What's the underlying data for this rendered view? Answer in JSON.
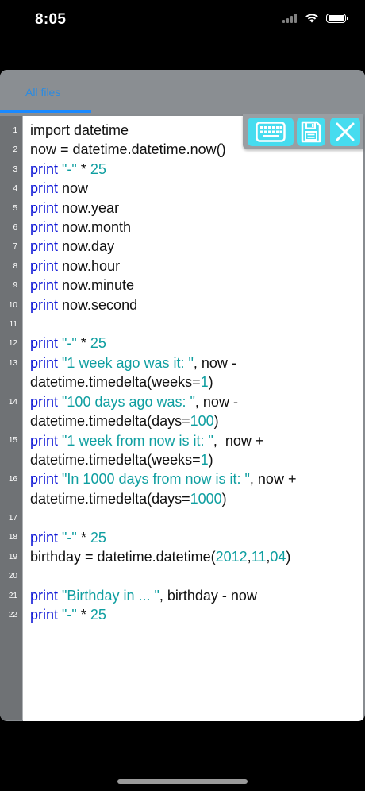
{
  "status_bar": {
    "time": "8:05"
  },
  "tabs": [
    {
      "label": "All files",
      "selected": true
    }
  ],
  "toolbar": {
    "keyboard_icon": "keyboard-icon",
    "save_icon": "floppy-disk-icon",
    "close_icon": "close-x-icon",
    "accent_color": "#46dcef"
  },
  "editor": {
    "line_numbers": [
      "1",
      "2",
      "3",
      "4",
      "5",
      "6",
      "7",
      "8",
      "9",
      "10",
      "11",
      "12",
      "13",
      "14",
      "15",
      "16",
      "17",
      "18",
      "19",
      "20",
      "21",
      "22"
    ],
    "lines": [
      [
        {
          "t": "import datetime",
          "c": ""
        }
      ],
      [
        {
          "t": "now = datetime.datetime.now()",
          "c": ""
        }
      ],
      [
        {
          "t": "print",
          "c": "kw"
        },
        {
          "t": " ",
          "c": ""
        },
        {
          "t": "\"-\"",
          "c": "str"
        },
        {
          "t": " * ",
          "c": ""
        },
        {
          "t": "25",
          "c": "num"
        }
      ],
      [
        {
          "t": "print",
          "c": "kw"
        },
        {
          "t": " now",
          "c": ""
        }
      ],
      [
        {
          "t": "print",
          "c": "kw"
        },
        {
          "t": " now.year",
          "c": ""
        }
      ],
      [
        {
          "t": "print",
          "c": "kw"
        },
        {
          "t": " now.month",
          "c": ""
        }
      ],
      [
        {
          "t": "print",
          "c": "kw"
        },
        {
          "t": " now.day",
          "c": ""
        }
      ],
      [
        {
          "t": "print",
          "c": "kw"
        },
        {
          "t": " now.hour",
          "c": ""
        }
      ],
      [
        {
          "t": "print",
          "c": "kw"
        },
        {
          "t": " now.minute",
          "c": ""
        }
      ],
      [
        {
          "t": "print",
          "c": "kw"
        },
        {
          "t": " now.second",
          "c": ""
        }
      ],
      [
        {
          "t": "",
          "c": ""
        }
      ],
      [
        {
          "t": "print",
          "c": "kw"
        },
        {
          "t": " ",
          "c": ""
        },
        {
          "t": "\"-\"",
          "c": "str"
        },
        {
          "t": " * ",
          "c": ""
        },
        {
          "t": "25",
          "c": "num"
        }
      ],
      [
        {
          "t": "print",
          "c": "kw"
        },
        {
          "t": " ",
          "c": ""
        },
        {
          "t": "\"1 week ago was it: \"",
          "c": "str"
        },
        {
          "t": ", now -",
          "c": ""
        }
      ],
      [
        {
          "t": "datetime.timedelta(weeks=",
          "c": ""
        },
        {
          "t": "1",
          "c": "num"
        },
        {
          "t": ")",
          "c": ""
        }
      ],
      [
        {
          "t": "print",
          "c": "kw"
        },
        {
          "t": " ",
          "c": ""
        },
        {
          "t": "\"100 days ago was: \"",
          "c": "str"
        },
        {
          "t": ", now -",
          "c": ""
        }
      ],
      [
        {
          "t": "datetime.timedelta(days=",
          "c": ""
        },
        {
          "t": "100",
          "c": "num"
        },
        {
          "t": ")",
          "c": ""
        }
      ],
      [
        {
          "t": "print",
          "c": "kw"
        },
        {
          "t": " ",
          "c": ""
        },
        {
          "t": "\"1 week from now is it: \"",
          "c": "str"
        },
        {
          "t": ",  now +",
          "c": ""
        }
      ],
      [
        {
          "t": "datetime.timedelta(weeks=",
          "c": ""
        },
        {
          "t": "1",
          "c": "num"
        },
        {
          "t": ")",
          "c": ""
        }
      ],
      [
        {
          "t": "print",
          "c": "kw"
        },
        {
          "t": " ",
          "c": ""
        },
        {
          "t": "\"In 1000 days from now is it: \"",
          "c": "str"
        },
        {
          "t": ", now +",
          "c": ""
        }
      ],
      [
        {
          "t": "datetime.timedelta(days=",
          "c": ""
        },
        {
          "t": "1000",
          "c": "num"
        },
        {
          "t": ")",
          "c": ""
        }
      ],
      [
        {
          "t": "",
          "c": ""
        }
      ],
      [
        {
          "t": "print",
          "c": "kw"
        },
        {
          "t": " ",
          "c": ""
        },
        {
          "t": "\"-\"",
          "c": "str"
        },
        {
          "t": " * ",
          "c": ""
        },
        {
          "t": "25",
          "c": "num"
        }
      ],
      [
        {
          "t": "birthday = datetime.datetime(",
          "c": ""
        },
        {
          "t": "2012",
          "c": "num"
        },
        {
          "t": ",",
          "c": ""
        },
        {
          "t": "11",
          "c": "num"
        },
        {
          "t": ",",
          "c": ""
        },
        {
          "t": "04",
          "c": "num"
        },
        {
          "t": ")",
          "c": ""
        }
      ],
      [
        {
          "t": "",
          "c": ""
        }
      ],
      [
        {
          "t": "print",
          "c": "kw"
        },
        {
          "t": " ",
          "c": ""
        },
        {
          "t": "\"Birthday in ... \"",
          "c": "str"
        },
        {
          "t": ", birthday - now",
          "c": ""
        }
      ],
      [
        {
          "t": "print",
          "c": "kw"
        },
        {
          "t": " ",
          "c": ""
        },
        {
          "t": "\"-\"",
          "c": "str"
        },
        {
          "t": " * ",
          "c": ""
        },
        {
          "t": "25",
          "c": "num"
        }
      ]
    ]
  }
}
